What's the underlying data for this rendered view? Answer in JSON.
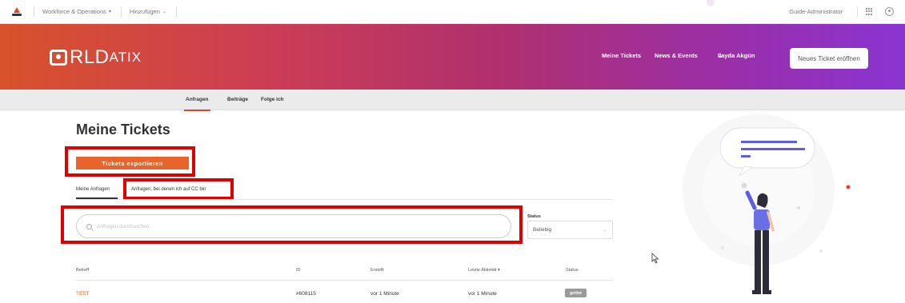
{
  "topbar": {
    "menu_1": "Workforce & Operations",
    "menu_2": "Hinzufügen",
    "guide": "Guide-Administrator"
  },
  "hero": {
    "brand_main": "RLD",
    "brand_small": "ATIX",
    "nav_tickets": "Meine Tickets",
    "nav_news": "News & Events",
    "user_name": "Ilayda Akgün",
    "new_ticket_button": "Neues Ticket eröffnen",
    "gradient_start": "#d8522b",
    "gradient_end": "#8a34d2"
  },
  "subnav": {
    "items": [
      "Anfragen",
      "Beiträge",
      "Folge ich"
    ],
    "active": "Anfragen"
  },
  "main": {
    "title": "Meine Tickets",
    "export_button": "Tickets exportieren",
    "tabs": [
      "Meine Anfragen",
      "Anfragen, bei denen ich auf CC bin"
    ],
    "search_placeholder": "Anfragen durchsuchen",
    "status_label": "Status",
    "status_value": "Beliebig",
    "highlight_color": "#e00000",
    "accent_color": "#e9642a"
  },
  "table": {
    "headers": [
      "Betreff",
      "ID",
      "Erstellt",
      "Letzte Aktivität ▾",
      "Status"
    ],
    "rows": [
      {
        "subject": "TEST",
        "id": "#608115",
        "created": "vor 1 Minute",
        "last_activity": "vor 1 Minute",
        "status": "gelöst"
      }
    ]
  }
}
